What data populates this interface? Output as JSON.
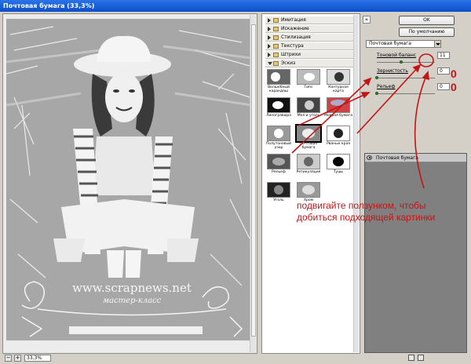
{
  "window": {
    "title": "Почтовая бумага (33,3%)"
  },
  "preview": {
    "watermark_main": "www.scrapnews.net",
    "watermark_sub": "мастер-класс",
    "zoom_value": "33,3%",
    "zoom_out_label": "−",
    "zoom_in_label": "+"
  },
  "gallery": {
    "folders": [
      {
        "label": "Имитация"
      },
      {
        "label": "Искажение"
      },
      {
        "label": "Стилизация"
      },
      {
        "label": "Текстура"
      },
      {
        "label": "Штрихи"
      },
      {
        "label": "Эскиз"
      }
    ],
    "thumbs": [
      {
        "label": "Волшебный карандаш"
      },
      {
        "label": "Гипс"
      },
      {
        "label": "Контурная карта"
      },
      {
        "label": "Линогравюра"
      },
      {
        "label": "Мел и уголь"
      },
      {
        "label": "Мокрая бумага"
      },
      {
        "label": "Полутоновый узор"
      },
      {
        "label": "Почтовая бумага"
      },
      {
        "label": "Рваные края"
      },
      {
        "label": "Рельеф"
      },
      {
        "label": "Ретикуляция"
      },
      {
        "label": "Тушь"
      },
      {
        "label": "Уголь"
      },
      {
        "label": "Хром"
      }
    ],
    "collapse_glyph": "«"
  },
  "buttons": {
    "ok": "OK",
    "default": "По умолчанию"
  },
  "settings": {
    "filter_select": "Почтовая бумага",
    "params": [
      {
        "label": "Тоновой баланс",
        "value": "11",
        "level": 0.42
      },
      {
        "label": "Зернистость",
        "value": "0",
        "level": 0.0
      },
      {
        "label": "Рельеф",
        "value": "0",
        "level": 0.0
      }
    ]
  },
  "layers": {
    "items": [
      {
        "label": "Почтовая бумага"
      }
    ]
  },
  "annotation": {
    "text": "подвигайте ползунком, чтобы добиться подходящей картинки",
    "zero_marks": [
      "0",
      "0"
    ],
    "color": "#c41414"
  }
}
